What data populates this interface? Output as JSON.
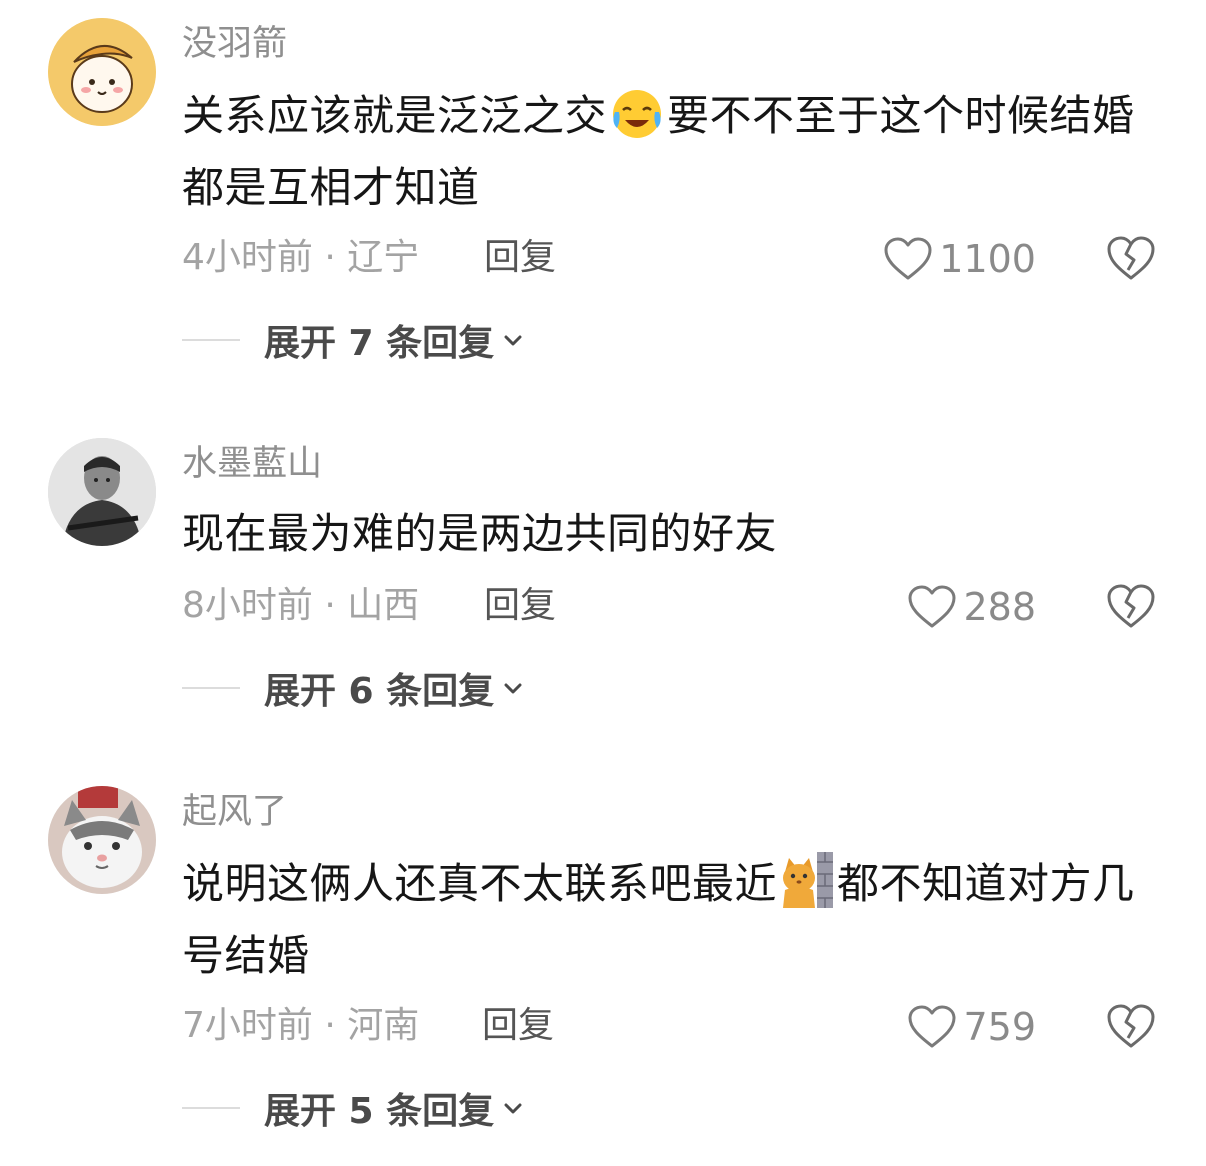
{
  "comments": [
    {
      "username": "没羽箭",
      "content_part1": "关系应该就是泛泛之交",
      "emoji": "crying-laughing-emoji",
      "content_part2": "要不不至于这个时候结婚都是互相才知道",
      "time": "4小时前 · 辽宁",
      "reply_label": "回复",
      "likes": "1100",
      "expand_label": "展开 7 条回复"
    },
    {
      "username": "水墨藍山",
      "content_part1": "现在最为难的是两边共同的好友",
      "content_part2": "",
      "time": "8小时前 · 山西",
      "reply_label": "回复",
      "likes": "288",
      "expand_label": "展开 6 条回复"
    },
    {
      "username": "起风了",
      "content_part1": "说明这俩人还真不太联系吧最近",
      "emoji": "cat-peeking-wall-emoji",
      "content_part2": "都不知道对方几号结婚",
      "time": "7小时前 · 河南",
      "reply_label": "回复",
      "likes": "759",
      "expand_label": "展开 5 条回复"
    }
  ],
  "icons": {
    "like": "heart-outline-icon",
    "dislike": "broken-heart-icon",
    "expand": "chevron-down-icon"
  },
  "colors": {
    "username": "#8f8f8f",
    "meta": "#a3a3a3",
    "content": "#161616"
  }
}
